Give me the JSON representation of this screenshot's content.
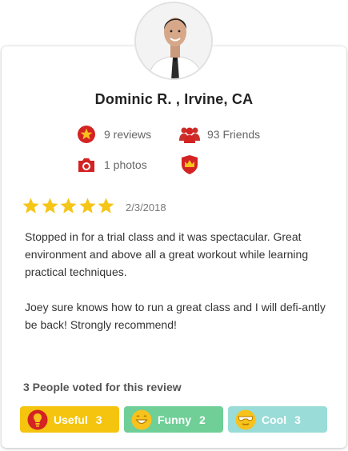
{
  "user": {
    "name": "Dominic R. , Irvine, CA",
    "reviews": "9 reviews",
    "friends": "93 Friends",
    "photos": "1 photos"
  },
  "review": {
    "rating": 5,
    "date": "2/3/2018",
    "paragraphs": [
      "Stopped in for a trial class and it was spectacular. Great environment and above all a great workout while learning practical techniques.",
      "Joey sure knows how to run a great class and I will defi-antly be back! Strongly recommend!"
    ]
  },
  "votes": {
    "summary": "3 People voted for this review",
    "useful": {
      "label": "Useful",
      "count": "3"
    },
    "funny": {
      "label": "Funny",
      "count": "2"
    },
    "cool": {
      "label": "Cool",
      "count": "3"
    }
  },
  "colors": {
    "brand_red": "#d32323",
    "star": "#f5c518",
    "useful_bg": "#f5c40f",
    "funny_bg": "#6fcf97",
    "cool_bg": "#9adcd7"
  },
  "icons": [
    "avatar-photo",
    "star-badge-icon",
    "friends-icon",
    "camera-icon",
    "elite-crown-icon",
    "lightbulb-icon",
    "smile-icon",
    "sunglasses-icon"
  ]
}
